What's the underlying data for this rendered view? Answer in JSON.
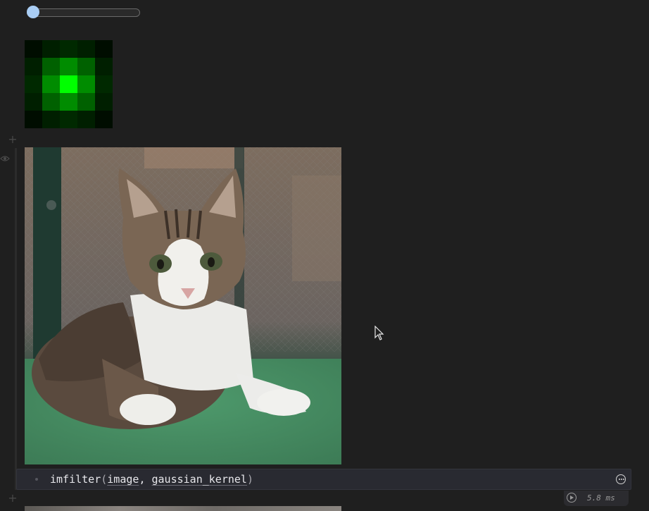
{
  "slider": {
    "value_fraction": 0.0
  },
  "kernel_heatmap": {
    "size": 5,
    "color": "#00ff00",
    "weights": [
      [
        0.05,
        0.12,
        0.16,
        0.12,
        0.05
      ],
      [
        0.12,
        0.38,
        0.55,
        0.38,
        0.12
      ],
      [
        0.16,
        0.55,
        1.0,
        0.55,
        0.16
      ],
      [
        0.12,
        0.38,
        0.55,
        0.38,
        0.12
      ],
      [
        0.05,
        0.12,
        0.16,
        0.12,
        0.05
      ]
    ]
  },
  "output_image": {
    "subject": "kitten lying on green grass"
  },
  "code_cell": {
    "fn": "imfilter",
    "open_paren": "(",
    "arg1": "image",
    "sep": ", ",
    "arg2": "gaussian_kernel",
    "close_paren": ")"
  },
  "runtime": {
    "label": "5.8 ms"
  },
  "icons": {
    "add_cell": "plus-icon",
    "visibility": "eye-icon",
    "cell_menu": "more-options-icon",
    "run": "play-icon"
  },
  "colors": {
    "background": "#1f1f1f",
    "code_cell_bg": "#292a31",
    "slider_thumb": "#a9cdf4"
  }
}
